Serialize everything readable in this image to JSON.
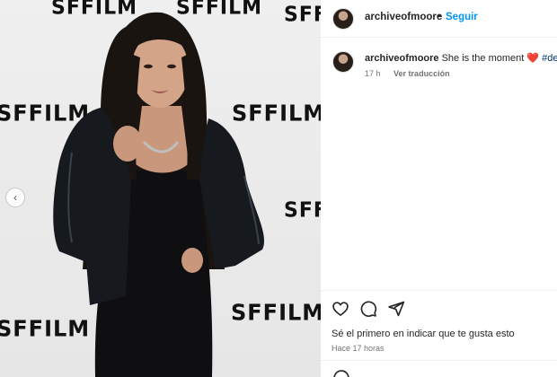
{
  "post": {
    "username": "archiveofmoore",
    "separator": "•",
    "follow_label": "Seguir",
    "caption": {
      "username": "archiveofmoore",
      "text": "She is the moment",
      "emoji": "❤️",
      "hashtag": "#dem"
    },
    "time_short": "17 h",
    "translate_label": "Ver traducción",
    "likes_text": "Sé el primero en indicar que te gusta esto",
    "time_long": "Hace 17 horas"
  },
  "photo": {
    "backdrop_logo": "SFFILM"
  },
  "icons": {
    "like": "heart-icon",
    "comment": "comment-icon",
    "share": "share-icon",
    "prev": "chevron-left-icon",
    "emoji": "emoji-icon"
  },
  "colors": {
    "accent": "#0095f6",
    "heart": "#ed4956",
    "hashtag": "#00376b",
    "muted": "#737373"
  }
}
